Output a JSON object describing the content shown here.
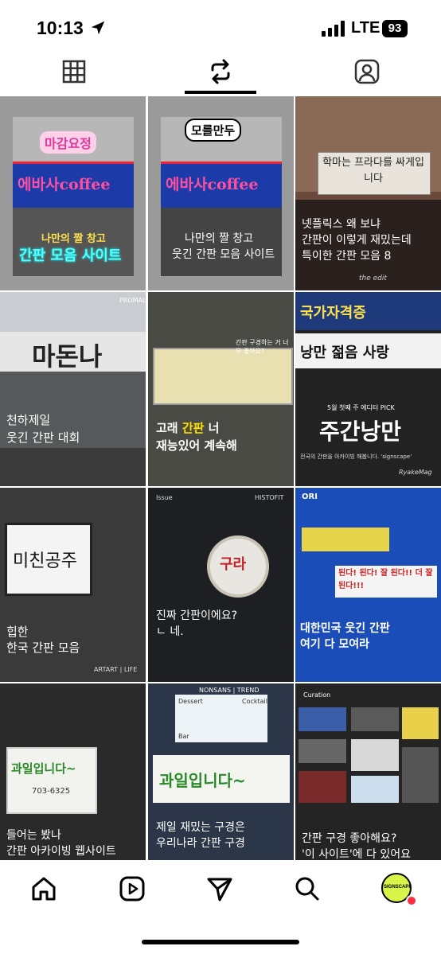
{
  "status": {
    "time": "10:13",
    "network": "LTE",
    "battery": "93"
  },
  "tabs": [
    {
      "icon": "grid-icon"
    },
    {
      "icon": "reels-repost-icon",
      "active": true
    },
    {
      "icon": "tagged-person-icon"
    }
  ],
  "posts": [
    {
      "badge": "마감요정",
      "sign": "에바사coffee",
      "line1": "나만의 짤 창고",
      "line2": "간판 모음 사이트"
    },
    {
      "badge": "모를만두",
      "sign": "에바사coffee",
      "line1": "나만의 짤 창고",
      "line2": "웃긴 간판 모음 사이트"
    },
    {
      "sign": "학마는 프라다를 싸게입니다",
      "line1": "넷플릭스 왜 보냐",
      "line2": "간판이 이렇게 재밌는데",
      "line3": "특이한 간판 모음 8",
      "footer": "the edit"
    },
    {
      "sign": "마돈나",
      "tag": "PROMAL",
      "line1": "천하제일",
      "line2": "웃긴 간판 대회"
    },
    {
      "tag": "간판 구경하는 거 너무 좋아요?",
      "line1_a": "고래 ",
      "line1_b": "간판",
      "line1_c": " 너",
      "line2": "재능있어 계속해"
    },
    {
      "sign1": "국가자격증",
      "sign2": "낭만 젊음 사랑",
      "kicker": "5월 첫째 주 에디터 PICK",
      "headline": "주간낭만",
      "sub": "전국의 간판을 아카이빙 해봅니다. 'signscape'",
      "footer": "RyakeMag"
    },
    {
      "sign": "미친공주",
      "line1": "힙한",
      "line2": "한국 간판 모음",
      "footer": "ARTART | LIFE"
    },
    {
      "issue": "Issue",
      "tag": "HISTOFIT",
      "sign": "구라",
      "line1": "진짜 간판이에요?",
      "line2": "ㄴ 네."
    },
    {
      "tag": "ORI",
      "sign": "된다! 된다! 잘 된다!! 더 잘 된다!!!",
      "line1": "대한민국 웃긴 간판",
      "line2": "여기 다 모여라"
    },
    {
      "sign": "과일입니다~",
      "phone": "703-6325",
      "line1": "들어는 봤나",
      "line2": "간판 아카이빙 웹사이트"
    },
    {
      "tag": "NONSANS | TREND",
      "label1": "Dessert",
      "label2": "Cocktail",
      "label3": "Bar",
      "sign": "과일입니다~",
      "line1": "제일 재밌는 구경은",
      "line2": "우리나라 간판 구경"
    },
    {
      "tag": "Curation",
      "line1": "간판 구경 좋아해요?",
      "line2": "'이 사이트'에 다 있어요"
    }
  ],
  "nav": [
    {
      "icon": "home-icon"
    },
    {
      "icon": "reels-icon"
    },
    {
      "icon": "send-icon"
    },
    {
      "icon": "search-icon"
    },
    {
      "icon": "profile-avatar-icon",
      "label": "SIGNSCAPE"
    }
  ]
}
